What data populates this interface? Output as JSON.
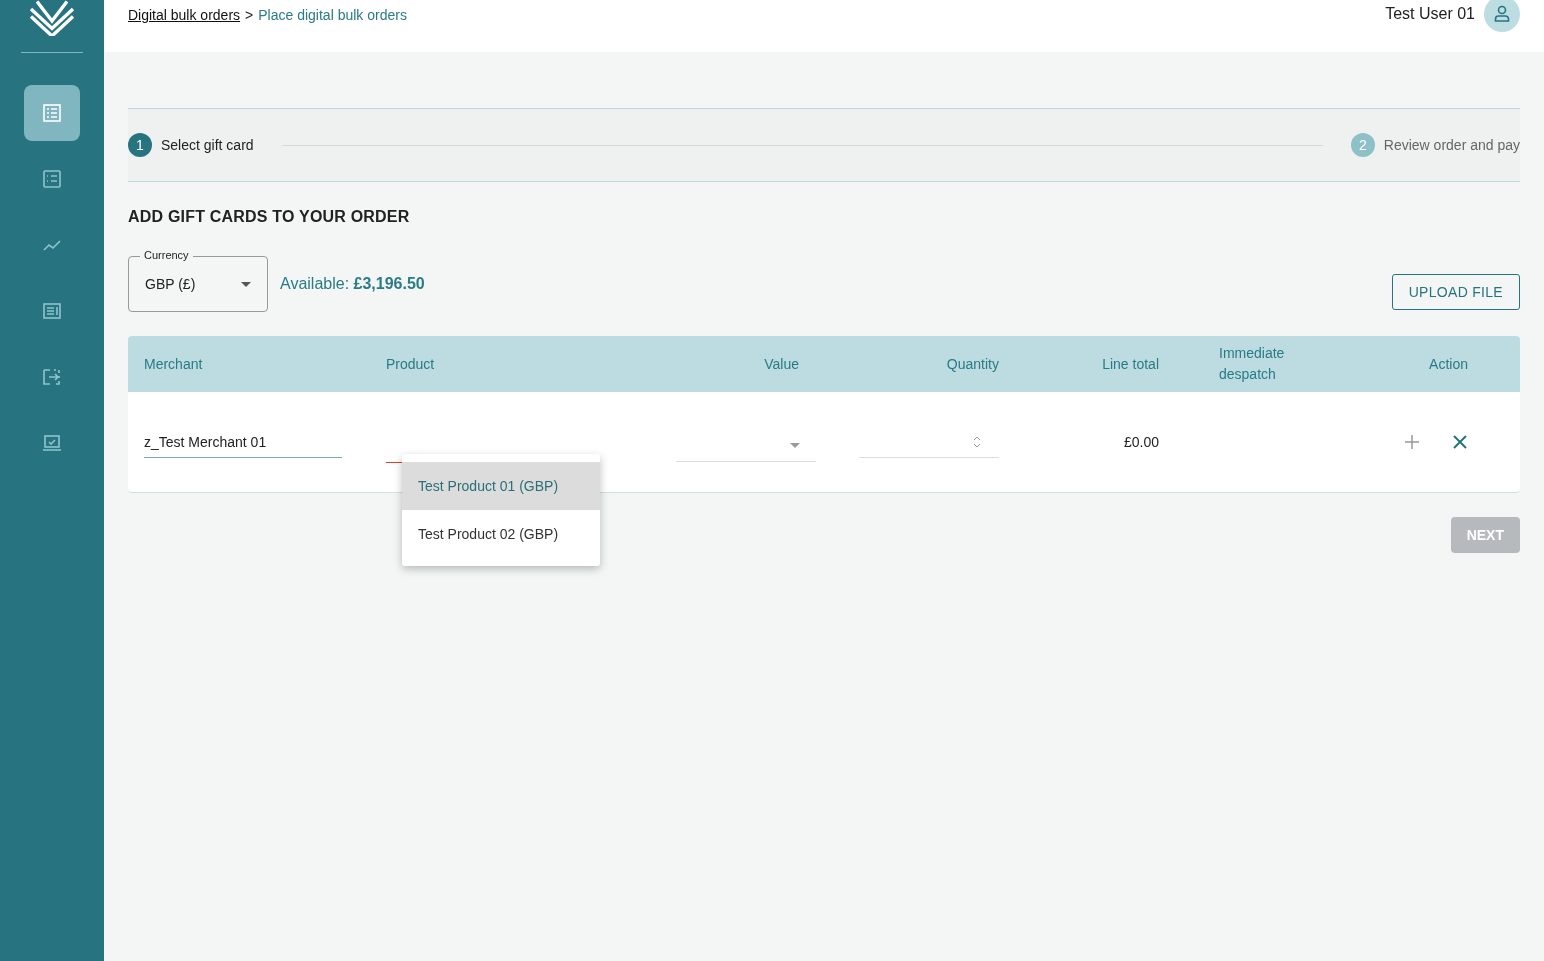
{
  "sidebar": {
    "items": [
      {
        "kind": "list",
        "selected": true
      },
      {
        "kind": "checklist",
        "selected": false
      },
      {
        "kind": "trend",
        "selected": false
      },
      {
        "kind": "document",
        "selected": false
      },
      {
        "kind": "transfer",
        "selected": false
      },
      {
        "kind": "laptop",
        "selected": false
      }
    ]
  },
  "breadcrumb": {
    "link": "Digital bulk orders",
    "separator": ">",
    "current": "Place digital bulk orders"
  },
  "user": {
    "name": "Test User 01"
  },
  "steps": [
    {
      "number": "1",
      "label": "Select gift card",
      "selected": true
    },
    {
      "number": "2",
      "label": "Review order and pay",
      "selected": false
    }
  ],
  "heading": "ADD GIFT CARDS TO YOUR ORDER",
  "currency": {
    "label": "Currency",
    "value": "GBP (£)"
  },
  "available": {
    "label": "Available:",
    "amount": "£3,196.50"
  },
  "upload_button": "UPLOAD FILE",
  "table": {
    "columns": [
      "Merchant",
      "Product",
      "Value",
      "Quantity",
      "Line total",
      "Immediate despatch",
      "Action"
    ],
    "rows": [
      {
        "merchant": "z_Test Merchant 01",
        "line_total": "£0.00"
      }
    ]
  },
  "product_dropdown": {
    "options": [
      {
        "label": "Test Product 01 (GBP)",
        "selected": true
      },
      {
        "label": "Test Product 02 (GBP)",
        "selected": false
      }
    ]
  },
  "next_button": {
    "label": "NEXT",
    "disabled": true
  }
}
